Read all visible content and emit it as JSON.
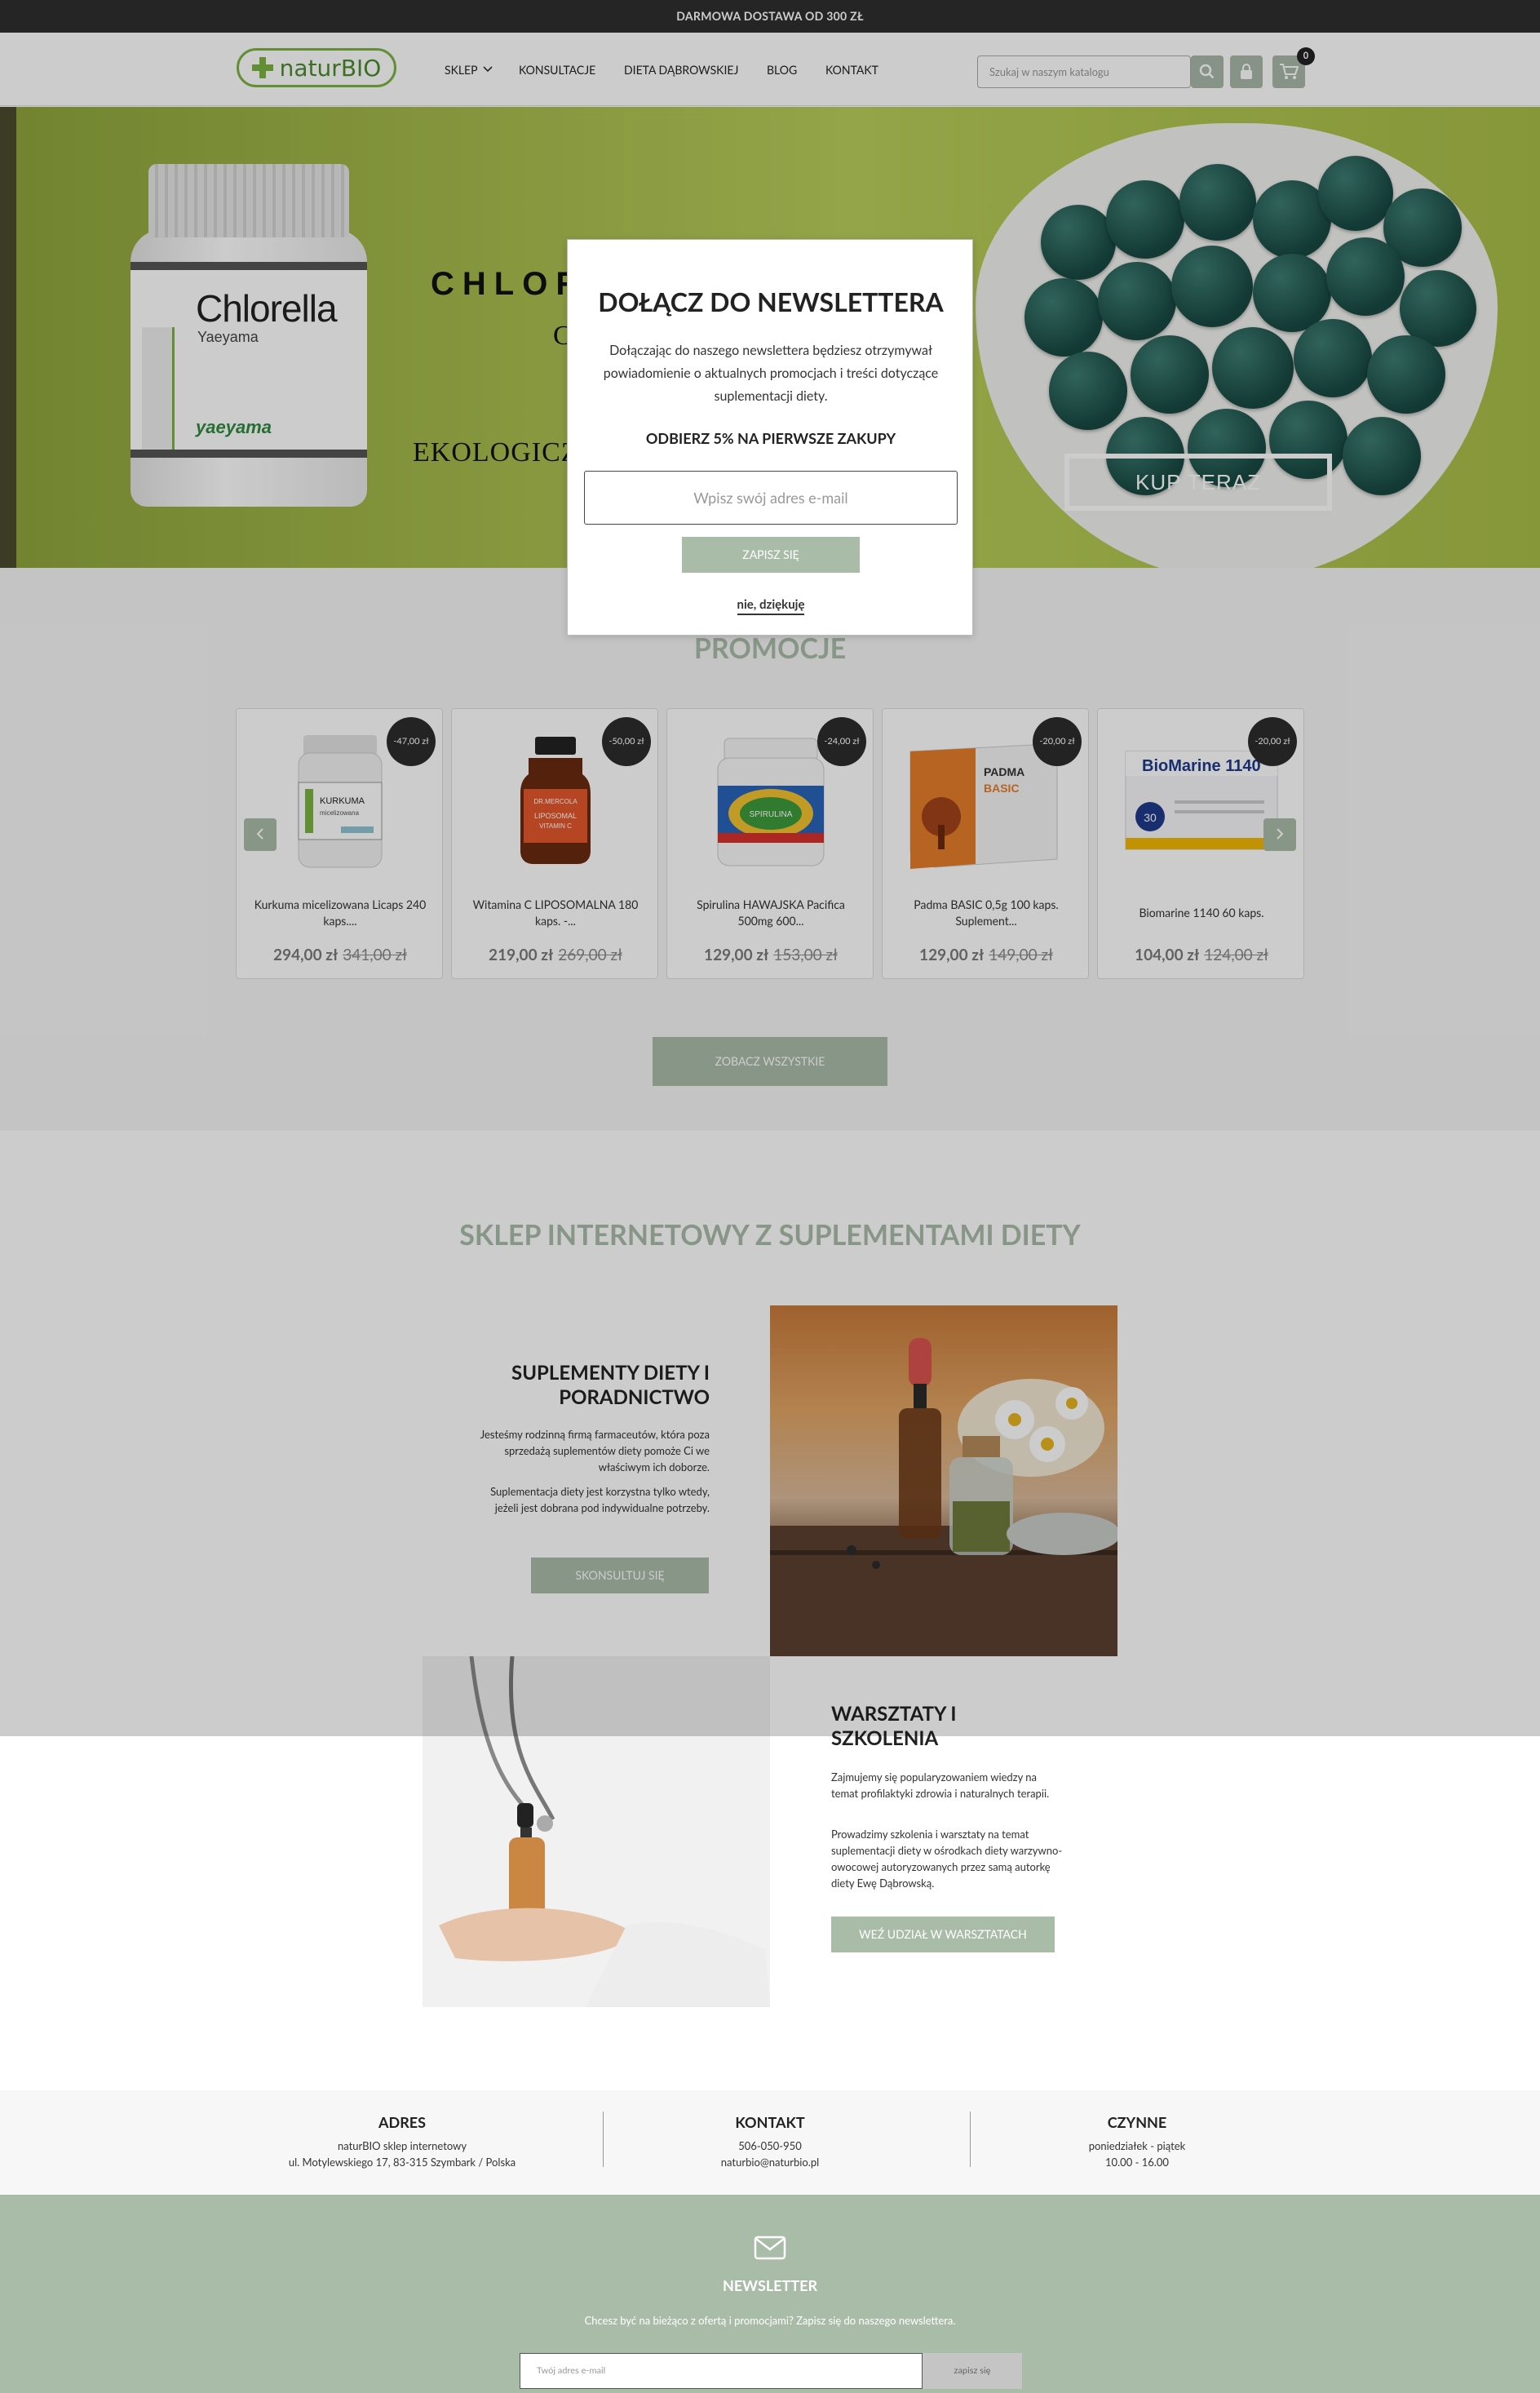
{
  "topbar": {
    "text": "DARMOWA DOSTAWA OD 300 ZŁ"
  },
  "header": {
    "logo_text": "naturBIO",
    "nav": [
      "SKLEP",
      "KONSULTACJE",
      "DIETA DĄBROWSKIEJ",
      "BLOG",
      "KONTAKT"
    ],
    "search_placeholder": "Szukaj w naszym katalogu",
    "cart_count": "0"
  },
  "hero": {
    "jar_name": "Chlorella",
    "jar_sub": "Yaeyama",
    "jar_brand": "yaeyama",
    "title": "CHLOR",
    "subtitle": "C",
    "eko": "EKOLOGICZ",
    "buy_label": "KUP TERAZ"
  },
  "modal": {
    "title": "DOŁĄCZ DO NEWSLETTERA",
    "text": "Dołączając do naszego newslettera będziesz otrzymywał powiadomienie o aktualnych promocjach i treści dotyczące suplementacji diety.",
    "promo": "ODBIERZ 5% NA PIERWSZE ZAKUPY",
    "email_placeholder": "Wpisz swój adres e-mail",
    "submit_label": "ZAPISZ SIĘ",
    "decline_label": "nie, dziękuję"
  },
  "promo": {
    "title": "PROMOCJE",
    "see_all": "ZOBACZ WSZYSTKIE",
    "products": [
      {
        "name": "Kurkuma micelizowana Licaps 240 kaps....",
        "price": "294,00 zł",
        "old": "341,00 zł",
        "badge": "-47,00 zł"
      },
      {
        "name": "Witamina C LIPOSOMALNA 180 kaps. -...",
        "price": "219,00 zł",
        "old": "269,00 zł",
        "badge": "-50,00 zł"
      },
      {
        "name": "Spirulina HAWAJSKA Pacifica 500mg 600...",
        "price": "129,00 zł",
        "old": "153,00 zł",
        "badge": "-24,00 zł"
      },
      {
        "name": "Padma BASIC 0,5g 100 kaps. Suplement...",
        "price": "129,00 zł",
        "old": "149,00 zł",
        "badge": "-20,00 zł"
      },
      {
        "name": "Biomarine 1140 60 kaps.",
        "price": "104,00 zł",
        "old": "124,00 zł",
        "badge": "-20,00 zł"
      }
    ]
  },
  "shop": {
    "title": "SKLEP INTERNETOWY Z SUPLEMENTAMI DIETY",
    "block1": {
      "title": "SUPLEMENTY DIETY I PORADNICTWO",
      "p1": "Jesteśmy rodzinną firmą farmaceutów, która poza sprzedażą suplementów diety pomoże Ci we właściwym ich doborze.",
      "p2": "Suplementacja diety jest korzystna tylko wtedy, jeżeli jest dobrana pod indywidualne potrzeby.",
      "button": "SKONSULTUJ SIĘ"
    },
    "block2": {
      "title": "WARSZTATY I SZKOLENIA",
      "p1": "Zajmujemy się popularyzowaniem wiedzy na temat profilaktyki zdrowia i naturalnych terapii.",
      "p2": "Prowadzimy szkolenia i warsztaty na temat suplementacji diety w ośrodkach diety warzywno- owocowej autoryzowanych przez samą autorkę diety Ewę Dąbrowską.",
      "button": "WEŹ UDZIAŁ W WARSZTATACH"
    }
  },
  "info": {
    "address": {
      "title": "ADRES",
      "line1": "naturBIO sklep internetowy",
      "line2": "ul. Motylewskiego 17, 83-315 Szymbark / Polska"
    },
    "contact": {
      "title": "KONTAKT",
      "line1": "506-050-950",
      "line2": "naturbio@naturbio.pl"
    },
    "hours": {
      "title": "CZYNNE",
      "line1": "poniedziałek - piątek",
      "line2": "10.00 - 16.00"
    }
  },
  "newsletter": {
    "title": "NEWSLETTER",
    "text": "Chcesz być na bieżąco z ofertą i promocjami? Zapisz się do naszego newslettera.",
    "placeholder": "Twój adres e-mail",
    "button": "zapisz się"
  }
}
